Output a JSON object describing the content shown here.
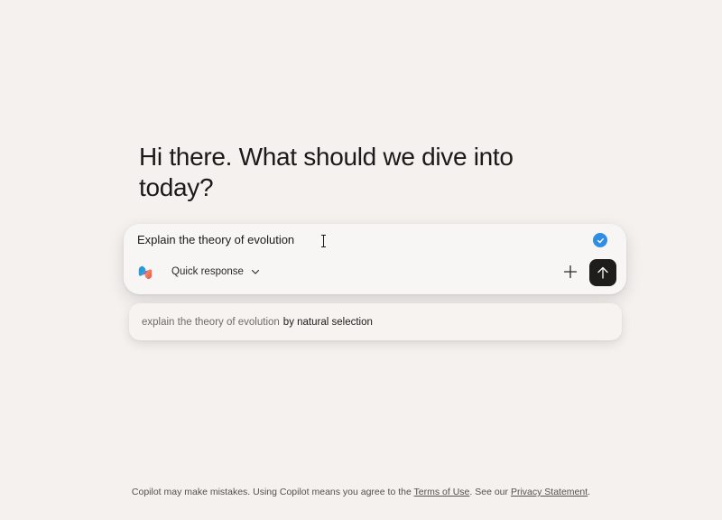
{
  "greeting": "Hi there. What should we dive into today?",
  "composer": {
    "input_value": "Explain the theory of evolution",
    "mode_label": "Quick response",
    "icons": {
      "logo": "copilot-logo-icon",
      "check": "check-badge-icon",
      "mode": "chevron-down-icon",
      "attach": "plus-icon",
      "send": "arrow-up-icon"
    }
  },
  "suggestion": {
    "prefix": "explain the theory of evolution",
    "completion": "by natural selection"
  },
  "footer": {
    "text_before": "Copilot may make mistakes. Using Copilot means you agree to the",
    "terms_link": "Terms of Use",
    "text_middle": ". See our",
    "privacy_link": "Privacy Statement",
    "text_after": "."
  },
  "colors": {
    "background": "#f4f1ee",
    "send_button": "#1f1d1c",
    "check_badge": "#2f8de4"
  }
}
